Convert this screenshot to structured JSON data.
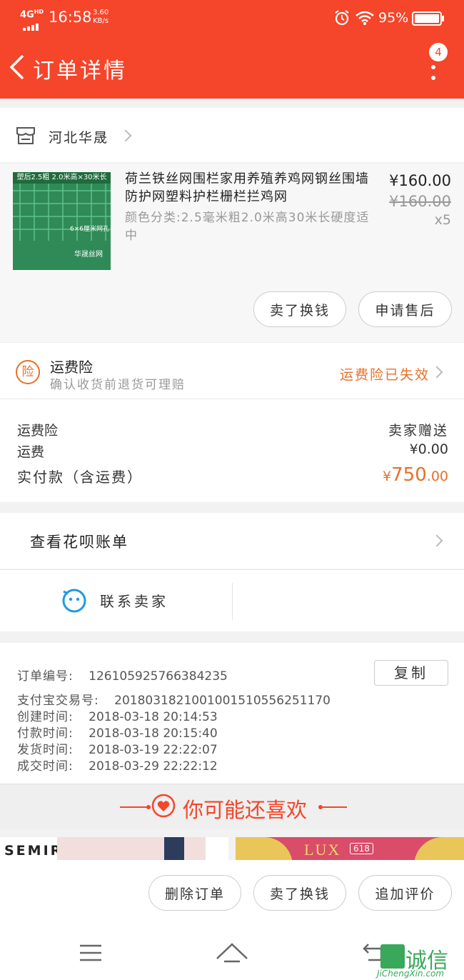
{
  "status_bar": {
    "network": "4G",
    "network_sup": "HD",
    "time": "16:58",
    "speed_value": "3.60",
    "speed_unit": "KB/s",
    "battery": "95%"
  },
  "header": {
    "title": "订单详情",
    "badge_count": "4"
  },
  "shop": {
    "name": "河北华晟"
  },
  "product": {
    "image_banner": "塑后2.5粗 2.0米高×30米长",
    "image_mesh_label": "6×6厘米网孔",
    "image_brand": "华晟丝网",
    "title": "荷兰铁丝网围栏家用养殖养鸡网钢丝围墙防护网塑料护栏栅栏拦鸡网",
    "spec": "颜色分类:2.5毫米粗2.0米高30米长硬度适中",
    "price": "¥160.00",
    "original_price": "¥160.00",
    "quantity": "x5",
    "sell_button": "卖了换钱",
    "after_sale_button": "申请售后"
  },
  "insurance": {
    "icon_text": "险",
    "title": "运费险",
    "subtitle": "确认收货前退货可理赔",
    "status": "运费险已失效"
  },
  "fees": {
    "rows": [
      {
        "label": "运费险",
        "value": "卖家赠送"
      },
      {
        "label": "运费",
        "value": "¥0.00"
      }
    ],
    "total_label": "实付款（含运费）",
    "total_currency": "¥",
    "total_integer": "750",
    "total_decimal": ".00"
  },
  "huabei": {
    "label": "查看花呗账单"
  },
  "contact": {
    "label": "联系卖家"
  },
  "order_info": {
    "copy_button": "复制",
    "rows": [
      {
        "label": "订单编号:",
        "value": "126105925766384235"
      },
      {
        "label": "支付宝交易号:",
        "value": "2018031821001001510556251170"
      },
      {
        "label": "创建时间:",
        "value": "2018-03-18 20:14:53"
      },
      {
        "label": "付款时间:",
        "value": "2018-03-18 20:15:40"
      },
      {
        "label": "发货时间:",
        "value": "2018-03-19 22:22:07"
      },
      {
        "label": "成交时间:",
        "value": "2018-03-29 22:22:12"
      }
    ]
  },
  "recommend": {
    "title": "你可能还喜欢",
    "item1_brand": "SEMIR",
    "item2_brand": "LUX",
    "item2_tag": "618"
  },
  "actions": {
    "delete": "删除订单",
    "sell": "卖了换钱",
    "review": "追加评价"
  },
  "watermark": {
    "brand": "诚信",
    "url": "JiChengXin.com"
  },
  "colors": {
    "accent": "#f5452a",
    "orange": "#e8702a"
  }
}
